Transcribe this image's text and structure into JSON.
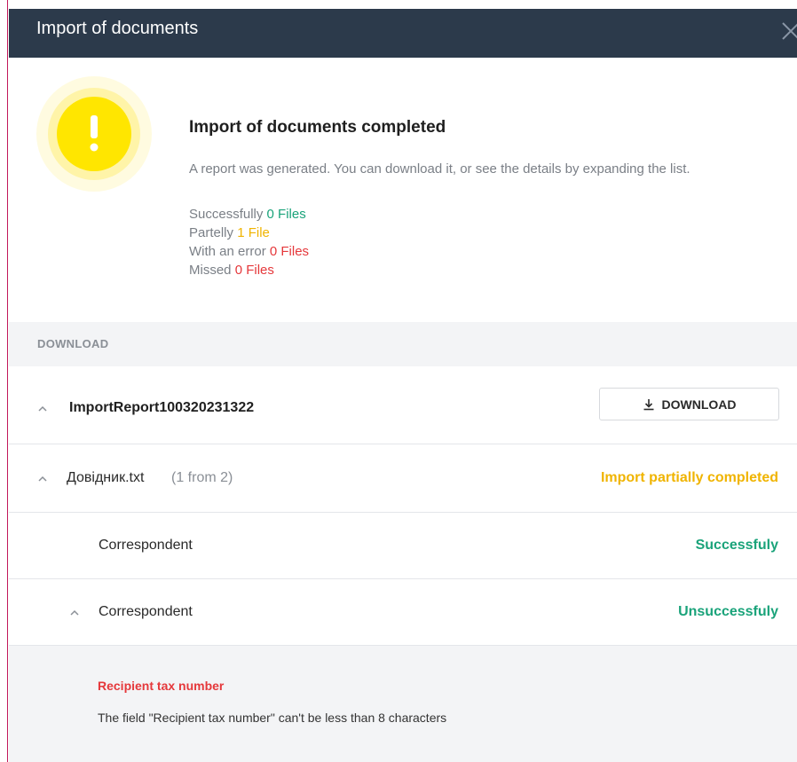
{
  "dialog": {
    "title": "Import of documents"
  },
  "summary": {
    "title": "Import of documents completed",
    "description": "A report was generated. You can download it, or see the details by expanding the list."
  },
  "stats": [
    {
      "label": "Successfully",
      "value": "0 Files",
      "color": "#1aa37a"
    },
    {
      "label": "Partelly",
      "value": "1 File",
      "color": "#f0b400"
    },
    {
      "label": "With an error",
      "value": "0 Files",
      "color": "#e5383b"
    },
    {
      "label": "Missed",
      "value": "0 Files",
      "color": "#e5383b"
    }
  ],
  "download_section": {
    "label": "DOWNLOAD"
  },
  "report": {
    "name": "ImportReport100320231322",
    "download_label": "DOWNLOAD"
  },
  "file": {
    "name": "Довідник.txt",
    "count": "(1 from 2)",
    "status": "Import partially completed"
  },
  "records": [
    {
      "label": "Correspondent",
      "status": "Successfuly"
    },
    {
      "label": "Correspondent",
      "status": "Unsuccessfuly"
    }
  ],
  "error": {
    "field": "Recipient tax number",
    "message": "The field \"Recipient tax number\" can't be less than 8 characters"
  },
  "colors": {
    "header_bg": "#2c3a4b",
    "success": "#1aa37a",
    "partial": "#f0b400",
    "error": "#e5383b",
    "warning_icon": "#ffe600"
  }
}
